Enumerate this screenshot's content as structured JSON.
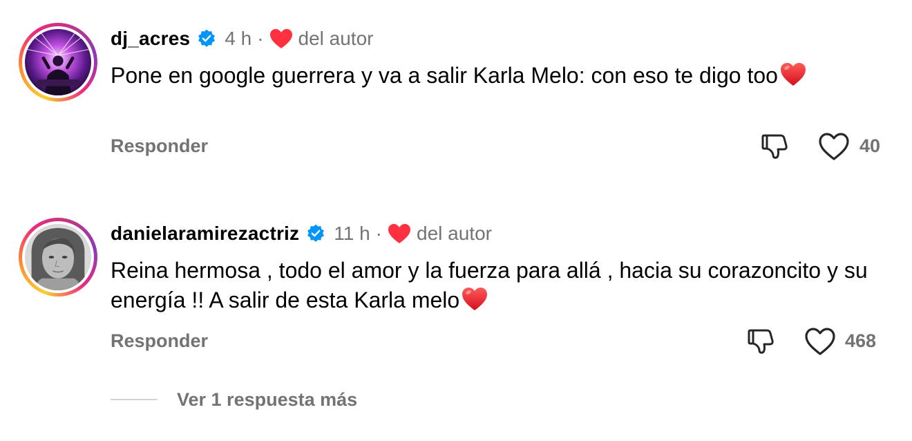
{
  "comments": [
    {
      "username": "dj_acres",
      "time": "4 h",
      "separator": "·",
      "author_like_label": "del autor",
      "text": "Pone en google guerrera y va a salir Karla Melo: con eso te digo too",
      "reply_label": "Responder",
      "like_count": "40",
      "avatar": "dj-stage-avatar"
    },
    {
      "username": "danielaramirezactriz",
      "time": "11 h",
      "separator": "·",
      "author_like_label": "del autor",
      "text": "Reina hermosa , todo el amor y la fuerza para allá , hacia su corazoncito y su energía !! A salir de esta Karla melo",
      "reply_label": "Responder",
      "like_count": "468",
      "avatar": "portrait-avatar"
    }
  ],
  "more_replies_label": "Ver 1 respuesta más",
  "icons": {
    "verified": "verified-badge-icon",
    "author_heart": "red-heart-icon",
    "dislike": "thumbs-down-icon",
    "like": "heart-outline-icon",
    "emoji": "red-heart-emoji"
  },
  "colors": {
    "verified_blue": "#0095f6",
    "heart_red": "#ff3040",
    "secondary_text": "#737373"
  }
}
